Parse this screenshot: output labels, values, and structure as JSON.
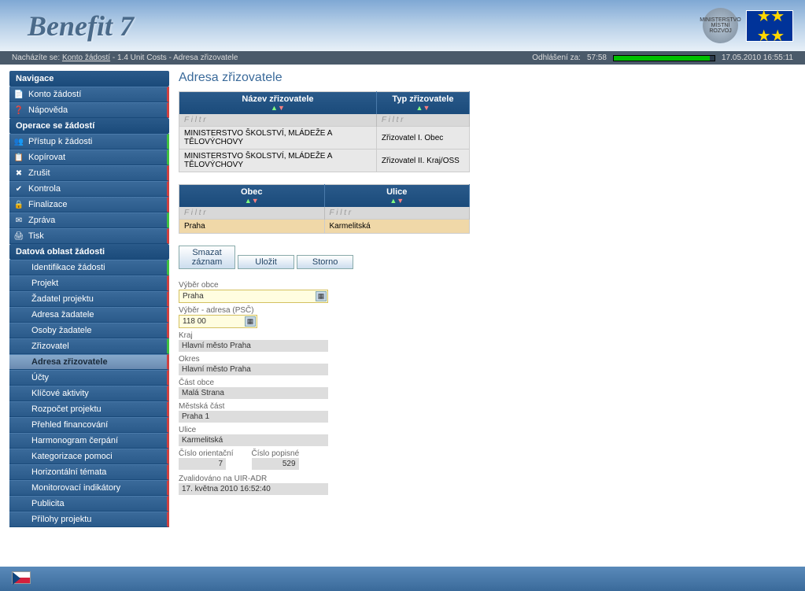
{
  "header": {
    "logo": "Benefit 7",
    "ministry": "MINISTERSTVO MÍSTNÍ ROZVOJ"
  },
  "breadcrumb": {
    "prefix": "Nacházíte se:",
    "link": "Konto žádostí",
    "rest": " - 1.4 Unit Costs - Adresa zřizovatele",
    "logout_label": "Odhlášení za:",
    "logout_time": "57:58",
    "datetime": "17.05.2010  16:55:11"
  },
  "nav": {
    "sect1": "Navigace",
    "items1": [
      {
        "label": "Konto žádostí",
        "icon": "📄"
      },
      {
        "label": "Nápověda",
        "icon": "❓"
      }
    ],
    "sect2": "Operace se žádostí",
    "items2": [
      {
        "label": "Přístup k žádosti",
        "icon": "👥",
        "edge": "green"
      },
      {
        "label": "Kopírovat",
        "icon": "📋",
        "edge": "green"
      },
      {
        "label": "Zrušit",
        "icon": "✖",
        "edge": "red"
      },
      {
        "label": "Kontrola",
        "icon": "✔",
        "edge": "red"
      },
      {
        "label": "Finalizace",
        "icon": "🔒",
        "edge": "red"
      },
      {
        "label": "Zpráva",
        "icon": "✉",
        "edge": "green"
      },
      {
        "label": "Tisk",
        "icon": "🖨",
        "edge": "red"
      }
    ],
    "sect3": "Datová oblast žádosti",
    "items3": [
      {
        "label": "Identifikace žádosti",
        "edge": "green"
      },
      {
        "label": "Projekt",
        "edge": "red"
      },
      {
        "label": "Žadatel projektu",
        "edge": "red"
      },
      {
        "label": "Adresa žadatele",
        "edge": "red"
      },
      {
        "label": "Osoby žadatele",
        "edge": "red"
      },
      {
        "label": "Zřizovatel",
        "edge": "green"
      },
      {
        "label": "Adresa zřizovatele",
        "edge": "red",
        "selected": true
      },
      {
        "label": "Účty",
        "edge": "red"
      },
      {
        "label": "Klíčové aktivity",
        "edge": "red"
      },
      {
        "label": "Rozpočet projektu",
        "edge": "red"
      },
      {
        "label": "Přehled financování",
        "edge": "red"
      },
      {
        "label": "Harmonogram čerpání",
        "edge": "red"
      },
      {
        "label": "Kategorizace pomoci",
        "edge": "red"
      },
      {
        "label": "Horizontální témata",
        "edge": "red"
      },
      {
        "label": "Monitorovací indikátory",
        "edge": "red"
      },
      {
        "label": "Publicita",
        "edge": "red"
      },
      {
        "label": "Přílohy projektu",
        "edge": "red"
      }
    ]
  },
  "page": {
    "title": "Adresa zřizovatele",
    "grid1": {
      "col1": "Název zřizovatele",
      "col2": "Typ zřizovatele",
      "filter": "F i l t r",
      "rows": [
        {
          "c1": "MINISTERSTVO ŠKOLSTVÍ, MLÁDEŽE A TĚLOVÝCHOVY",
          "c2": "Zřizovatel I. Obec"
        },
        {
          "c1": "MINISTERSTVO ŠKOLSTVÍ, MLÁDEŽE A TĚLOVÝCHOVY",
          "c2": "Zřizovatel II. Kraj/OSS"
        }
      ]
    },
    "grid2": {
      "col1": "Obec",
      "col2": "Ulice",
      "filter": "F i l t r",
      "rows": [
        {
          "c1": "Praha",
          "c2": "Karmelitská"
        }
      ]
    },
    "buttons": {
      "delete": "Smazat záznam",
      "save": "Uložit",
      "cancel": "Storno"
    },
    "form": {
      "vyber_obce_label": "Výběr obce",
      "vyber_obce": "Praha",
      "vyber_adresa_label": "Výběr - adresa (PSČ)",
      "vyber_adresa": "118 00",
      "kraj_label": "Kraj",
      "kraj": "Hlavní město Praha",
      "okres_label": "Okres",
      "okres": "Hlavní město Praha",
      "cast_obce_label": "Část obce",
      "cast_obce": "Malá Strana",
      "mestska_cast_label": "Městská část",
      "mestska_cast": "Praha 1",
      "ulice_label": "Ulice",
      "ulice": "Karmelitská",
      "cislo_orient_label": "Číslo orientační",
      "cislo_orient": "7",
      "cislo_popisne_label": "Číslo popisné",
      "cislo_popisne": "529",
      "zvalidovano_label": "Zvalidováno na UIR-ADR",
      "zvalidovano": "17. května 2010 16:52:40"
    }
  }
}
